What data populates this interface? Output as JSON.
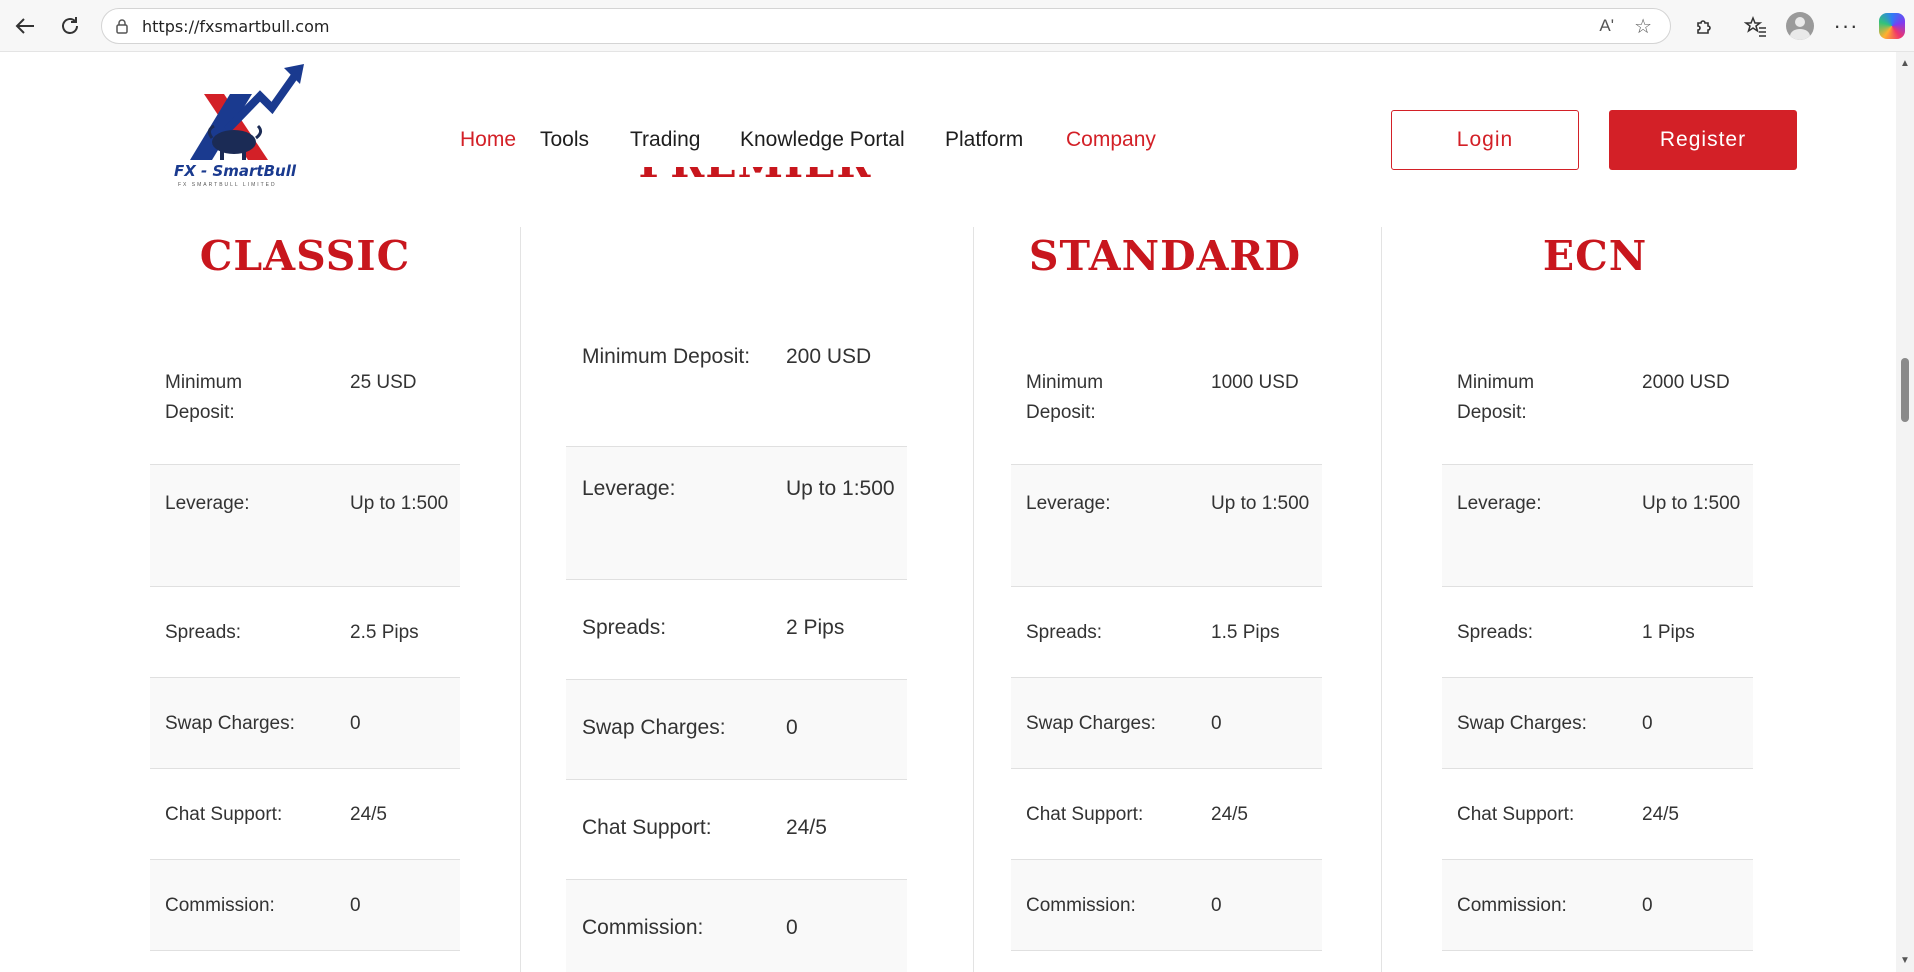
{
  "browser": {
    "url": "https://fxsmartbull.com",
    "read_aloud_icon": "Aʹ",
    "icons": [
      "back-arrow-icon",
      "refresh-icon",
      "lock-icon",
      "read-aloud-icon",
      "favorite-star-icon",
      "extensions-icon",
      "favorites-icon",
      "profile-avatar-icon",
      "more-icon",
      "copilot-icon"
    ]
  },
  "site": {
    "logo": {
      "brand": "FX - SmartBull",
      "subtitle": "FX SMARTBULL LIMITED"
    },
    "nav": [
      {
        "label": "Home",
        "active": true
      },
      {
        "label": "Tools",
        "active": false
      },
      {
        "label": "Trading",
        "active": false
      },
      {
        "label": "Knowledge Portal",
        "active": false
      },
      {
        "label": "Platform",
        "active": false
      },
      {
        "label": "Company",
        "active": true
      }
    ],
    "login_label": "Login",
    "register_label": "Register",
    "accent_color": "#d32027"
  },
  "accounts": [
    {
      "title": "CLASSIC",
      "rows": [
        {
          "label": "Minimum Deposit:",
          "value": "25 USD"
        },
        {
          "label": "Leverage:",
          "value": "Up to 1:500"
        },
        {
          "label": "Spreads:",
          "value": "2.5 Pips"
        },
        {
          "label": "Swap Charges:",
          "value": "0"
        },
        {
          "label": "Chat Support:",
          "value": "24/5"
        },
        {
          "label": "Commission:",
          "value": "0"
        }
      ]
    },
    {
      "title": "PREMIER",
      "rows": [
        {
          "label": "Minimum Deposit:",
          "value": "200 USD"
        },
        {
          "label": "Leverage:",
          "value": "Up to 1:500"
        },
        {
          "label": "Spreads:",
          "value": "2 Pips"
        },
        {
          "label": "Swap Charges:",
          "value": "0"
        },
        {
          "label": "Chat Support:",
          "value": "24/5"
        },
        {
          "label": "Commission:",
          "value": "0"
        }
      ]
    },
    {
      "title": "STANDARD",
      "rows": [
        {
          "label": "Minimum Deposit:",
          "value": "1000 USD"
        },
        {
          "label": "Leverage:",
          "value": "Up to 1:500"
        },
        {
          "label": "Spreads:",
          "value": "1.5 Pips"
        },
        {
          "label": "Swap Charges:",
          "value": "0"
        },
        {
          "label": "Chat Support:",
          "value": "24/5"
        },
        {
          "label": "Commission:",
          "value": "0"
        }
      ]
    },
    {
      "title": "ECN",
      "rows": [
        {
          "label": "Minimum Deposit:",
          "value": "2000 USD"
        },
        {
          "label": "Leverage:",
          "value": "Up to 1:500"
        },
        {
          "label": "Spreads:",
          "value": "1 Pips"
        },
        {
          "label": "Swap Charges:",
          "value": "0"
        },
        {
          "label": "Chat Support:",
          "value": "24/5"
        },
        {
          "label": "Commission:",
          "value": "0"
        }
      ]
    }
  ]
}
